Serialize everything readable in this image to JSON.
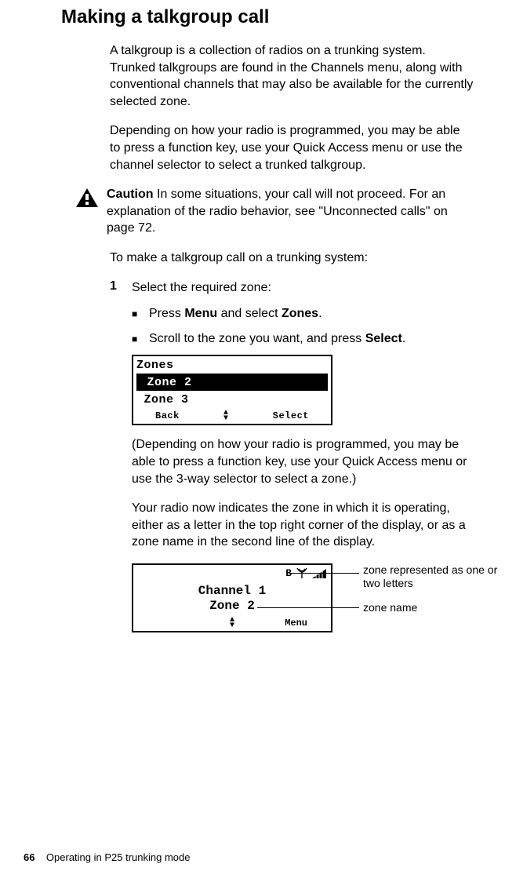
{
  "title": "Making a talkgroup call",
  "para1": "A talkgroup is a collection of radios on a trunking system. Trunked talkgroups are found in the Channels menu, along with conventional channels that may also be available for the currently selected zone.",
  "para2": "Depending on how your radio is programmed, you may be able to press a function key, use your Quick Access menu or use the channel selector to select a trunked talkgroup.",
  "caution_label": "Caution",
  "caution_text": "In some situations, your call will not proceed. For an explanation of the radio behavior, see \"Unconnected calls\" on page 72.",
  "para3": "To make a talkgroup call on a trunking system:",
  "step1_num": "1",
  "step1_text": "Select the required zone:",
  "bullet1_pre": "Press ",
  "bullet1_b1": "Menu",
  "bullet1_mid": " and select ",
  "bullet1_b2": "Zones",
  "bullet1_post": ".",
  "bullet2_pre": "Scroll to the zone you want, and press ",
  "bullet2_b1": "Select",
  "bullet2_post": ".",
  "lcd1": {
    "header": "Zones",
    "item_selected": "Zone 2",
    "item2": "Zone 3",
    "softkey_left": "Back",
    "softkey_right": "Select"
  },
  "para4": "(Depending on how your radio is programmed, you may be able to press a function key, use your Quick Access menu or use the 3-way selector to select a zone.)",
  "para5": "Your radio now indicates the zone in which it is operating, either as a letter in the top right corner of the display, or as a zone name in the second line of the display.",
  "lcd2": {
    "zone_letter": "B",
    "line1": "Channel 1",
    "line2": "Zone 2",
    "softkey_right": "Menu"
  },
  "annot1": "zone represented as one or two letters",
  "annot2": "zone name",
  "footer_page": "66",
  "footer_section": "Operating in P25 trunking mode"
}
